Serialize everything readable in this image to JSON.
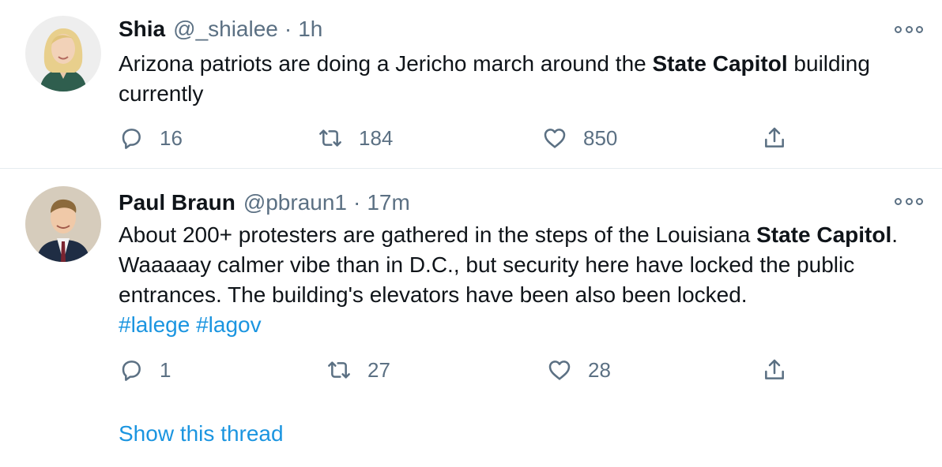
{
  "tweets": [
    {
      "name": "Shia",
      "handle": "@_shialee",
      "separator": "·",
      "time": "1h",
      "text_parts": [
        {
          "text": "Arizona patriots are doing a Jericho march around the "
        },
        {
          "text": "State Capitol",
          "bold": true
        },
        {
          "text": " building currently"
        }
      ],
      "hashtags": [],
      "actions": {
        "replies": "16",
        "retweets": "184",
        "likes": "850"
      }
    },
    {
      "name": "Paul Braun",
      "handle": "@pbraun1",
      "separator": "·",
      "time": "17m",
      "text_parts": [
        {
          "text": "About 200+ protesters are gathered in the steps of the Louisiana "
        },
        {
          "text": "State Capitol",
          "bold": true
        },
        {
          "text": ". Waaaaay calmer vibe than in D.C., but security here have locked the public entrances. The building's elevators have been also been locked. "
        }
      ],
      "hashtags": [
        "#lalege",
        "#lagov"
      ],
      "actions": {
        "replies": "1",
        "retweets": "27",
        "likes": "28"
      }
    }
  ],
  "show_thread": "Show this thread",
  "icons": {
    "reply": "reply-icon",
    "retweet": "retweet-icon",
    "like": "heart-icon",
    "share": "share-icon",
    "more": "more-options-icon"
  },
  "colors": {
    "text": "#0f1419",
    "secondary": "#5b7083",
    "link": "#1b95e0",
    "divider": "#e6ecf0"
  }
}
